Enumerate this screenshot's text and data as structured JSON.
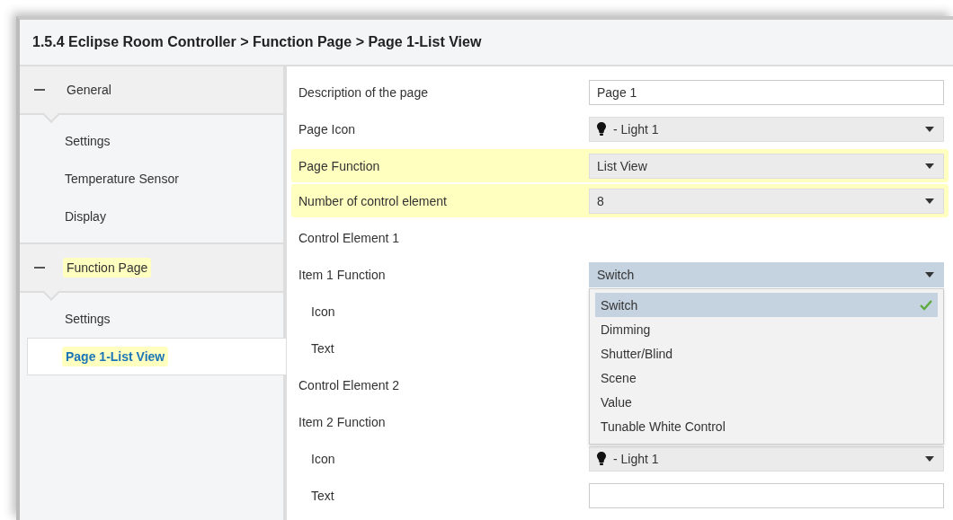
{
  "window": {
    "title": "1.5.4 Eclipse Room Controller > Function Page > Page 1-List View"
  },
  "sidebar": {
    "groups": [
      {
        "label": "General",
        "expanded": true,
        "highlighted": false,
        "children": [
          {
            "label": "Settings",
            "selected": false,
            "highlighted": false
          },
          {
            "label": "Temperature Sensor",
            "selected": false,
            "highlighted": false
          },
          {
            "label": "Display",
            "selected": false,
            "highlighted": false
          }
        ]
      },
      {
        "label": "Function Page",
        "expanded": true,
        "highlighted": true,
        "children": [
          {
            "label": "Settings",
            "selected": false,
            "highlighted": false
          },
          {
            "label": "Page 1-List View",
            "selected": true,
            "highlighted": true
          }
        ]
      }
    ]
  },
  "parameters": [
    {
      "kind": "text_field",
      "label": "Description of the page",
      "value": "Page 1",
      "highlighted": false,
      "indented": false
    },
    {
      "kind": "dropdown",
      "label": "Page Icon",
      "value": "- Light 1",
      "icon": true,
      "highlighted": false,
      "indented": false,
      "open": false
    },
    {
      "kind": "dropdown",
      "label": "Page Function",
      "value": "List View",
      "highlighted": true,
      "indented": false,
      "open": false
    },
    {
      "kind": "dropdown",
      "label": "Number of control element",
      "value": "8",
      "highlighted": true,
      "indented": false,
      "open": false
    },
    {
      "kind": "header",
      "label": "Control Element 1",
      "highlighted": false,
      "indented": false
    },
    {
      "kind": "dropdown",
      "label": "Item 1 Function",
      "value": "Switch",
      "highlighted": false,
      "indented": false,
      "open": true,
      "options": [
        {
          "label": "Switch",
          "selected": true
        },
        {
          "label": "Dimming",
          "selected": false
        },
        {
          "label": "Shutter/Blind",
          "selected": false
        },
        {
          "label": "Scene",
          "selected": false
        },
        {
          "label": "Value",
          "selected": false
        },
        {
          "label": "Tunable White Control",
          "selected": false
        }
      ]
    },
    {
      "kind": "label",
      "label": "Icon",
      "highlighted": false,
      "indented": true
    },
    {
      "kind": "label",
      "label": "Text",
      "highlighted": false,
      "indented": true
    },
    {
      "kind": "header",
      "label": "Control Element 2",
      "highlighted": false,
      "indented": false
    },
    {
      "kind": "label",
      "label": "Item 2 Function",
      "highlighted": false,
      "indented": false
    },
    {
      "kind": "dropdown",
      "label": "Icon",
      "value": "- Light 1",
      "icon": true,
      "highlighted": false,
      "indented": true,
      "open": false
    },
    {
      "kind": "text_field",
      "label": "Text",
      "highlighted": false,
      "indented": true
    }
  ]
}
